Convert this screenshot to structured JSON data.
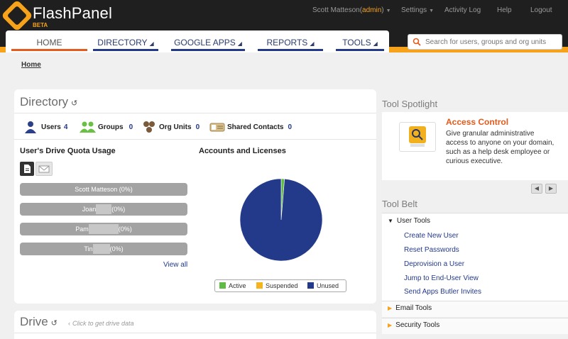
{
  "brand": {
    "name": "FlashPanel",
    "badge": "BETA"
  },
  "top_links": {
    "user_name": "Scott Matteson",
    "user_role": "admin",
    "settings": "Settings",
    "activity_log": "Activity Log",
    "help": "Help",
    "logout": "Logout"
  },
  "nav": {
    "tabs": [
      {
        "label": "HOME",
        "has_menu": false,
        "active": true
      },
      {
        "label": "DIRECTORY",
        "has_menu": true
      },
      {
        "label": "GOOGLE APPS",
        "has_menu": true
      },
      {
        "label": "REPORTS",
        "has_menu": true
      },
      {
        "label": "TOOLS",
        "has_menu": true
      }
    ],
    "menu_glyph": "◢"
  },
  "search": {
    "placeholder": "Search for users, groups and org units"
  },
  "breadcrumb": "Home",
  "directory": {
    "title": "Directory",
    "stats": [
      {
        "label": "Users",
        "count": "4"
      },
      {
        "label": "Groups",
        "count": "0"
      },
      {
        "label": "Org Units",
        "count": "0"
      },
      {
        "label": "Shared Contacts",
        "count": "0"
      }
    ],
    "quota": {
      "title": "User's Drive Quota Usage",
      "rows": [
        {
          "label": "Scott Matteson (0%)"
        },
        {
          "label_pre": "Joan",
          "label_post": "(0%)"
        },
        {
          "label_pre": "Pam",
          "label_post": "(0%)"
        },
        {
          "label_pre": "Tin",
          "label_post": "(0%)"
        }
      ],
      "view_all": "View all"
    },
    "accounts": {
      "title": "Accounts and Licenses",
      "legend": [
        "Active",
        "Suspended",
        "Unused"
      ]
    }
  },
  "chart_data": {
    "type": "pie",
    "title": "Accounts and Licenses",
    "labels": [
      "Active",
      "Suspended",
      "Unused"
    ],
    "values": [
      1.3,
      0,
      98.7
    ],
    "colors": [
      "#5fbb46",
      "#f5b41e",
      "#233a8a"
    ],
    "legend": "bottom"
  },
  "drive": {
    "title": "Drive",
    "hint": "Click to get drive data"
  },
  "tool_spotlight": {
    "title": "Tool Spotlight",
    "item_title": "Access Control",
    "item_desc": "Give granular administrative access to anyone on your domain, such as a help desk employee or curious executive."
  },
  "tool_belt": {
    "title": "Tool Belt",
    "open_section": "User Tools",
    "links": [
      "Create New User",
      "Reset Passwords",
      "Deprovision a User",
      "Jump to End-User View",
      "Send Apps Butler Invites"
    ],
    "sections": [
      "Email Tools",
      "Security Tools"
    ]
  },
  "colors": {
    "accent": "#f7a21b",
    "nav_blue": "#233a8a",
    "active_tab": "#e45a1f",
    "spotlight_title": "#e25a1c"
  }
}
